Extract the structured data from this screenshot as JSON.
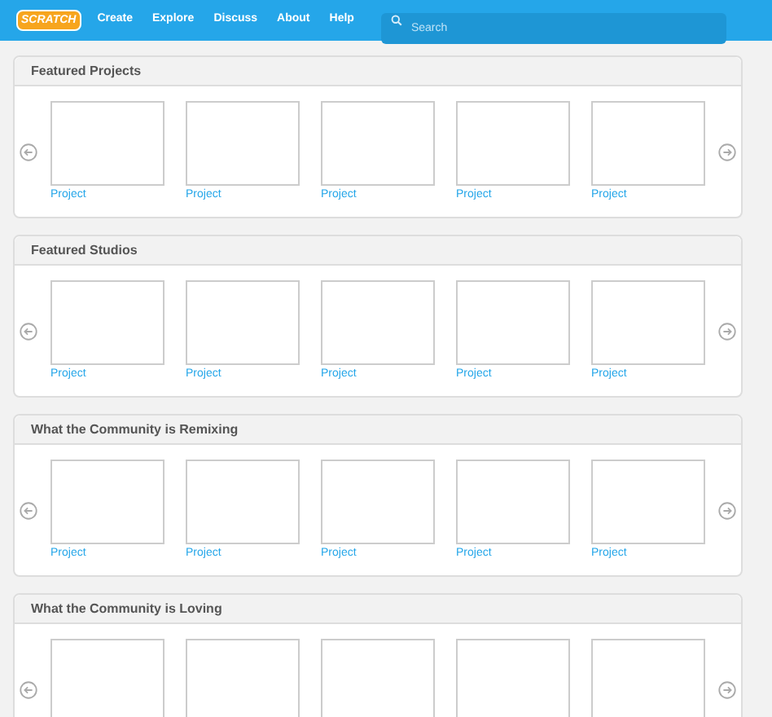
{
  "nav": {
    "logo": "SCRATCH",
    "links": [
      "Create",
      "Explore",
      "Discuss",
      "About",
      "Help"
    ],
    "search": {
      "placeholder": "Search"
    }
  },
  "sections": [
    {
      "title": "Featured Projects",
      "items": [
        {
          "kind": "project",
          "label": "Project"
        },
        {
          "kind": "project",
          "label": "Project"
        },
        {
          "kind": "project",
          "label": "Project"
        },
        {
          "kind": "project",
          "label": "Project"
        },
        {
          "kind": "project",
          "label": "Project"
        }
      ]
    },
    {
      "title": "Featured Studios",
      "items": [
        {
          "kind": "project",
          "label": "Project"
        },
        {
          "kind": "project",
          "label": "Project"
        },
        {
          "kind": "project",
          "label": "Project"
        },
        {
          "kind": "project",
          "label": "Project"
        },
        {
          "kind": "project",
          "label": "Project"
        }
      ]
    },
    {
      "title": "What the Community is Remixing",
      "items": [
        {
          "kind": "project",
          "label": "Project"
        },
        {
          "kind": "project",
          "label": "Project"
        },
        {
          "kind": "project",
          "label": "Project"
        },
        {
          "kind": "project",
          "label": "Project"
        },
        {
          "kind": "project",
          "label": "Project"
        }
      ]
    },
    {
      "title": "What the Community is Loving",
      "items": [
        {
          "kind": "project"
        },
        {
          "kind": "project"
        },
        {
          "kind": "project"
        },
        {
          "kind": "project"
        },
        {
          "kind": "project"
        }
      ]
    }
  ]
}
